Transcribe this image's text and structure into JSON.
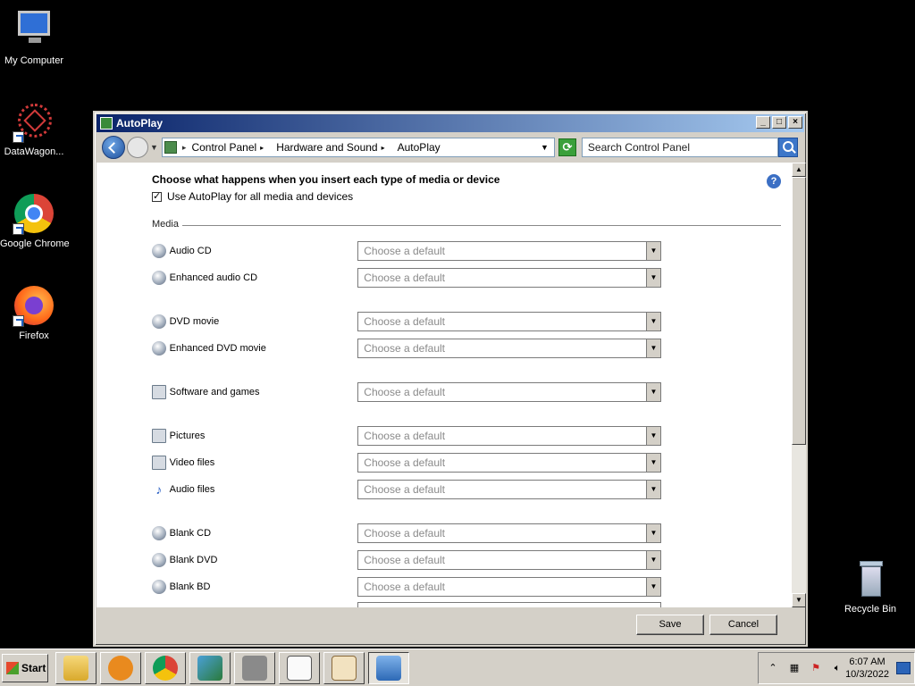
{
  "desktop": {
    "icons": [
      {
        "label": "My Computer",
        "icon": "computer-icon"
      },
      {
        "label": "DataWagon...",
        "icon": "datawagon-icon"
      },
      {
        "label": "Google Chrome",
        "icon": "chrome-icon"
      },
      {
        "label": "Firefox",
        "icon": "firefox-icon"
      },
      {
        "label": "Recycle Bin",
        "icon": "recycle-bin-icon"
      }
    ]
  },
  "window": {
    "title": "AutoPlay",
    "breadcrumb": [
      "Control Panel",
      "Hardware and Sound",
      "AutoPlay"
    ],
    "search_placeholder": "Search Control Panel",
    "heading": "Choose what happens when you insert each type of media or device",
    "use_all_label": "Use AutoPlay for all media and devices",
    "use_all_checked": true,
    "section_media": "Media",
    "select_placeholder": "Choose a default",
    "media_items": [
      {
        "label": "Audio CD",
        "icon": "disc-icon"
      },
      {
        "label": "Enhanced audio CD",
        "icon": "disc-icon"
      },
      {
        "label": "DVD movie",
        "icon": "dvd-icon"
      },
      {
        "label": "Enhanced DVD movie",
        "icon": "dvd-icon"
      },
      {
        "label": "Software and games",
        "icon": "software-icon"
      },
      {
        "label": "Pictures",
        "icon": "pictures-icon"
      },
      {
        "label": "Video files",
        "icon": "video-icon"
      },
      {
        "label": "Audio files",
        "icon": "music-note-icon"
      },
      {
        "label": "Blank CD",
        "icon": "blank-disc-icon"
      },
      {
        "label": "Blank DVD",
        "icon": "blank-disc-icon"
      },
      {
        "label": "Blank BD",
        "icon": "blank-disc-icon"
      }
    ],
    "buttons": {
      "save": "Save",
      "cancel": "Cancel"
    }
  },
  "taskbar": {
    "start_label": "Start",
    "clock_time": "6:07 AM",
    "clock_date": "10/3/2022"
  }
}
